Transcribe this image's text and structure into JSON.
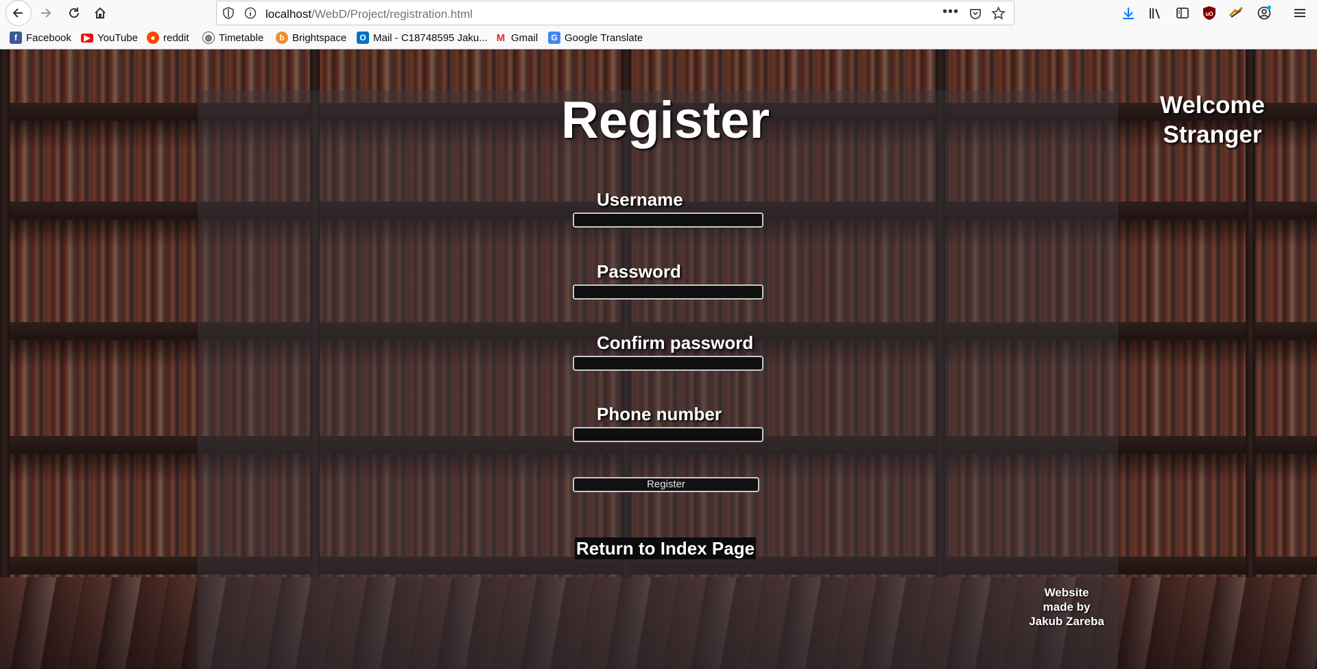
{
  "browser": {
    "url_host": "localhost",
    "url_path": "/WebD/Project/registration.html",
    "more_label": "•••",
    "bookmarks": [
      {
        "label": "Facebook",
        "icon": "facebook-icon",
        "color": "#3b5998"
      },
      {
        "label": "YouTube",
        "icon": "youtube-icon",
        "color": "#ff0000"
      },
      {
        "label": "reddit",
        "icon": "reddit-icon",
        "color": "#ff4500"
      },
      {
        "label": "Timetable",
        "icon": "globe-icon",
        "color": "#5a5a5a"
      },
      {
        "label": "Brightspace",
        "icon": "brightspace-icon",
        "color": "#f28c28"
      },
      {
        "label": "Mail - C18748595 Jaku...",
        "icon": "outlook-icon",
        "color": "#0072c6"
      },
      {
        "label": "Gmail",
        "icon": "gmail-icon",
        "color": "#d93025"
      },
      {
        "label": "Google Translate",
        "icon": "translate-icon",
        "color": "#4285f4"
      }
    ]
  },
  "page": {
    "title": "Register",
    "welcome_line1": "Welcome",
    "welcome_line2": "Stranger",
    "fields": {
      "username_label": "Username",
      "password_label": "Password",
      "confirm_label": "Confirm password",
      "phone_label": "Phone number"
    },
    "register_button": "Register",
    "return_link": "Return to Index Page",
    "credit_line1": "Website",
    "credit_line2": "made by",
    "credit_line3": "Jakub Zareba"
  }
}
